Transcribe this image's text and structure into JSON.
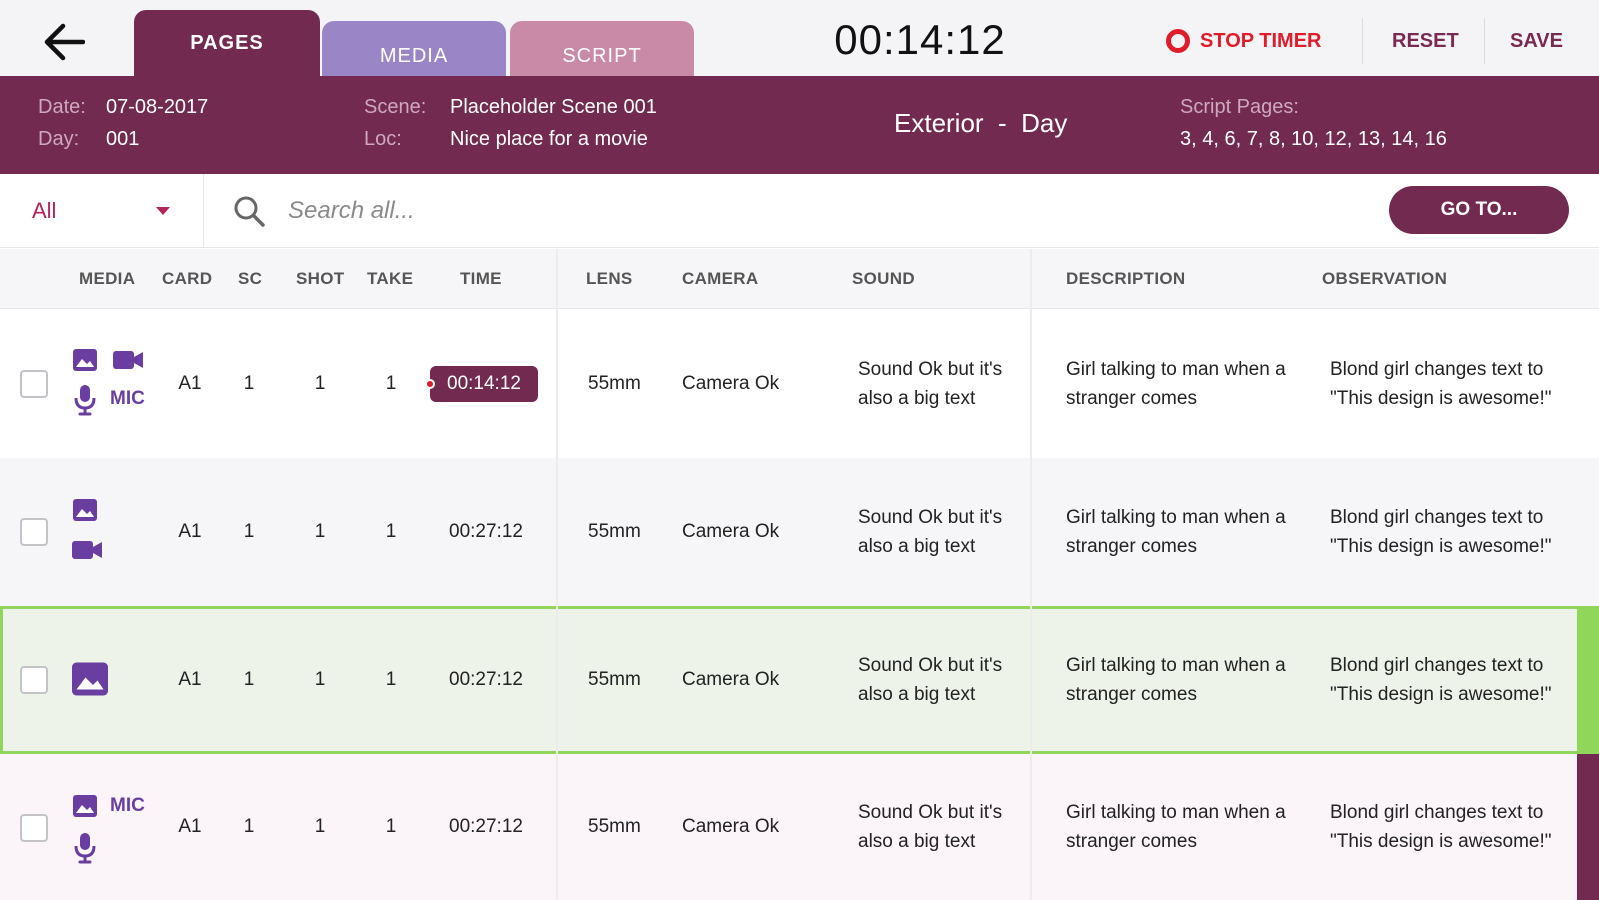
{
  "colors": {
    "brand": "#722a50",
    "tab_pages": "#722a50",
    "tab_media": "#9a86c6",
    "tab_script": "#c98aa8",
    "accent_red": "#e01b2a",
    "icon_purple": "#6a3ea0",
    "best_green": "#8fd65a",
    "row_alt": "#f6f6f8",
    "row_best": "#eef3ea",
    "row_last": "#fbf5f9"
  },
  "header": {
    "tabs": [
      {
        "label": "PAGES",
        "active": true
      },
      {
        "label": "MEDIA",
        "active": false
      },
      {
        "label": "SCRIPT",
        "active": false
      }
    ],
    "timer": "00:14:12",
    "stop_timer_label": "STOP TIMER",
    "reset_label": "RESET",
    "save_label": "SAVE"
  },
  "info": {
    "date_label": "Date:",
    "date_value": "07-08-2017",
    "day_label": "Day:",
    "day_value": "001",
    "scene_label": "Scene:",
    "scene_value": "Placeholder Scene 001",
    "loc_label": "Loc:",
    "loc_value": "Nice place for a movie",
    "setting": "Exterior  -  Day",
    "script_pages_label": "Script Pages:",
    "script_pages_value": "3, 4, 6, 7, 8, 10, 12, 13, 14, 16"
  },
  "search": {
    "filter_value": "All",
    "placeholder": "Search all...",
    "goto_label": "GO TO..."
  },
  "columns": {
    "media": "MEDIA",
    "card": "CARD",
    "sc": "SC",
    "shot": "SHOT",
    "take": "TAKE",
    "time": "TIME",
    "lens": "LENS",
    "camera": "CAMERA",
    "sound": "SOUND",
    "description": "DESCRIPTION",
    "observation": "OBSERVATION"
  },
  "rows": [
    {
      "card": "A1",
      "sc": "1",
      "shot": "1",
      "take": "1",
      "time": "00:14:12",
      "lens": "55mm",
      "camera": "Camera Ok",
      "sound": "Sound Ok but it's also a big text",
      "description": "Girl talking to man when a stranger comes",
      "observation": "Blond girl changes text to \"This design is awesome!\"",
      "mic_label": "MIC"
    },
    {
      "card": "A1",
      "sc": "1",
      "shot": "1",
      "take": "1",
      "time": "00:27:12",
      "lens": "55mm",
      "camera": "Camera Ok",
      "sound": "Sound Ok but it's also a big text",
      "description": "Girl talking to man when a stranger comes",
      "observation": "Blond girl changes text to \"This design is awesome!\""
    },
    {
      "card": "A1",
      "sc": "1",
      "shot": "1",
      "take": "1",
      "time": "00:27:12",
      "lens": "55mm",
      "camera": "Camera Ok",
      "sound": "Sound Ok but it's also a big text",
      "description": "Girl talking to man when a stranger comes",
      "observation": "Blond girl changes text to \"This design is awesome!\""
    },
    {
      "card": "A1",
      "sc": "1",
      "shot": "1",
      "take": "1",
      "time": "00:27:12",
      "lens": "55mm",
      "camera": "Camera Ok",
      "sound": "Sound Ok but it's also a big text",
      "description": "Girl talking to man when a stranger comes",
      "observation": "Blond girl changes text to \"This design is awesome!\"",
      "mic_label": "MIC"
    }
  ]
}
